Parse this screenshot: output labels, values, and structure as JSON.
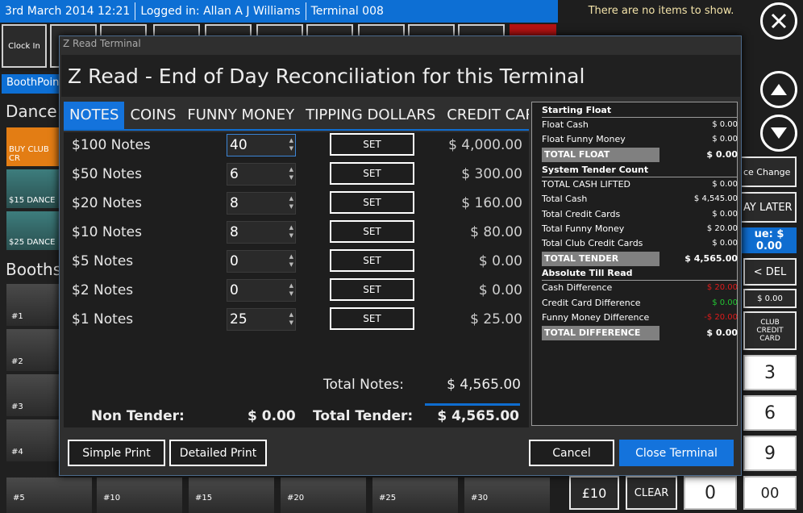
{
  "topbar": {
    "date": "3rd March 2014 12:21",
    "logged_in": "Logged in: Allan A J Williams",
    "terminal": "Terminal 008"
  },
  "top_buttons": {
    "clock_in": "Clock In"
  },
  "left_panel": {
    "booth_tab": "BoothPoint",
    "dance_header": "Dance",
    "items": [
      "BUY CLUB CR",
      "$15 DANCE",
      "$25 DANCE"
    ],
    "booths_header": "Booths",
    "booths": [
      "#1",
      "#2",
      "#3",
      "#4",
      "#5",
      "#10",
      "#15",
      "#20",
      "#25",
      "#30"
    ]
  },
  "right_panel": {
    "no_items": "There are no items to show.",
    "price_change": "ce Change",
    "pay_later": "AY LATER",
    "due": "ue: $ 0.00",
    "del": "< DEL",
    "zero_small": "$ 0.00",
    "club_credit_card": "CLUB CREDIT CARD",
    "keys": [
      "3",
      "6",
      "9",
      "0",
      "00"
    ],
    "ten": "£10",
    "clear": "CLEAR"
  },
  "modal": {
    "window_title": "Z Read Terminal",
    "heading": "Z Read - End of Day Reconciliation for this Terminal",
    "tabs": [
      "NOTES",
      "COINS",
      "FUNNY MONEY",
      "TIPPING DOLLARS",
      "CREDIT CARDS"
    ],
    "set_label": "SET",
    "notes": [
      {
        "label": "$100 Notes",
        "qty": "40",
        "total": "$ 4,000.00"
      },
      {
        "label": "$50 Notes",
        "qty": "6",
        "total": "$ 300.00"
      },
      {
        "label": "$20 Notes",
        "qty": "8",
        "total": "$ 160.00"
      },
      {
        "label": "$10 Notes",
        "qty": "8",
        "total": "$ 80.00"
      },
      {
        "label": "$5 Notes",
        "qty": "0",
        "total": "$ 0.00"
      },
      {
        "label": "$2 Notes",
        "qty": "0",
        "total": "$ 0.00"
      },
      {
        "label": "$1 Notes",
        "qty": "25",
        "total": "$ 25.00"
      }
    ],
    "total_notes_label": "Total Notes:",
    "total_notes_value": "$ 4,565.00",
    "non_tender_label": "Non Tender:",
    "non_tender_value": "$ 0.00",
    "total_tender_label": "Total Tender:",
    "total_tender_value": "$ 4,565.00",
    "summary": {
      "starting_float_header": "Starting Float",
      "float_cash": [
        "Float Cash",
        "$ 0.00"
      ],
      "float_funny": [
        "Float Funny Money",
        "$ 0.00"
      ],
      "total_float": [
        "TOTAL FLOAT",
        "$ 0.00"
      ],
      "system_header": "System Tender Count",
      "cash_lifted": [
        "TOTAL CASH LIFTED",
        "$ 0.00"
      ],
      "total_cash": [
        "Total Cash",
        "$ 4,545.00"
      ],
      "total_credit": [
        "Total Credit Cards",
        "$ 0.00"
      ],
      "total_funny": [
        "Total Funny Money",
        "$ 20.00"
      ],
      "total_club_credit": [
        "Total Club Credit Cards",
        "$ 0.00"
      ],
      "total_tender": [
        "TOTAL TENDER",
        "$ 4,565.00"
      ],
      "absolute_header": "Absolute Till Read",
      "cash_diff": [
        "Cash Difference",
        "$ 20.00"
      ],
      "cc_diff": [
        "Credit Card Difference",
        "$ 0.00"
      ],
      "funny_diff": [
        "Funny Money Difference",
        "-$ 20.00"
      ],
      "total_diff": [
        "TOTAL DIFFERENCE",
        "$ 0.00"
      ]
    },
    "buttons": {
      "simple_print": "Simple Print",
      "detailed_print": "Detailed Print",
      "cancel": "Cancel",
      "close_terminal": "Close Terminal"
    }
  },
  "colors": {
    "accent": "#1473dc",
    "negative": "#e01b1b",
    "positive": "#22c432"
  }
}
